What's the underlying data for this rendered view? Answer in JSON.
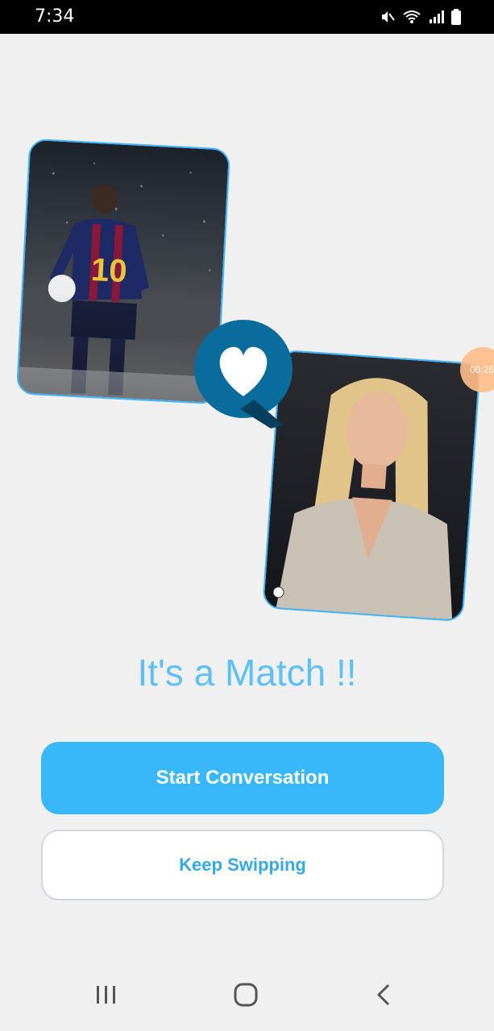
{
  "status_bar": {
    "time": "7:34",
    "icons": [
      "mute-icon",
      "wifi-icon",
      "signal-icon",
      "battery-icon"
    ]
  },
  "match": {
    "title": "It's a Match !!",
    "left_photo": "profile-photo-user",
    "right_photo": "profile-photo-match",
    "badge_icon": "heart-icon"
  },
  "overlay": {
    "timer": "00:26"
  },
  "actions": {
    "start_label": "Start Conversation",
    "keep_label": "Keep Swipping"
  },
  "nav": {
    "icons": [
      "recent-apps-icon",
      "home-icon",
      "back-icon"
    ]
  },
  "colors": {
    "accent": "#39b7fb",
    "title": "#5ec0f5",
    "card_border": "#3cb4ff",
    "heart_badge": "#0a6c9c"
  }
}
